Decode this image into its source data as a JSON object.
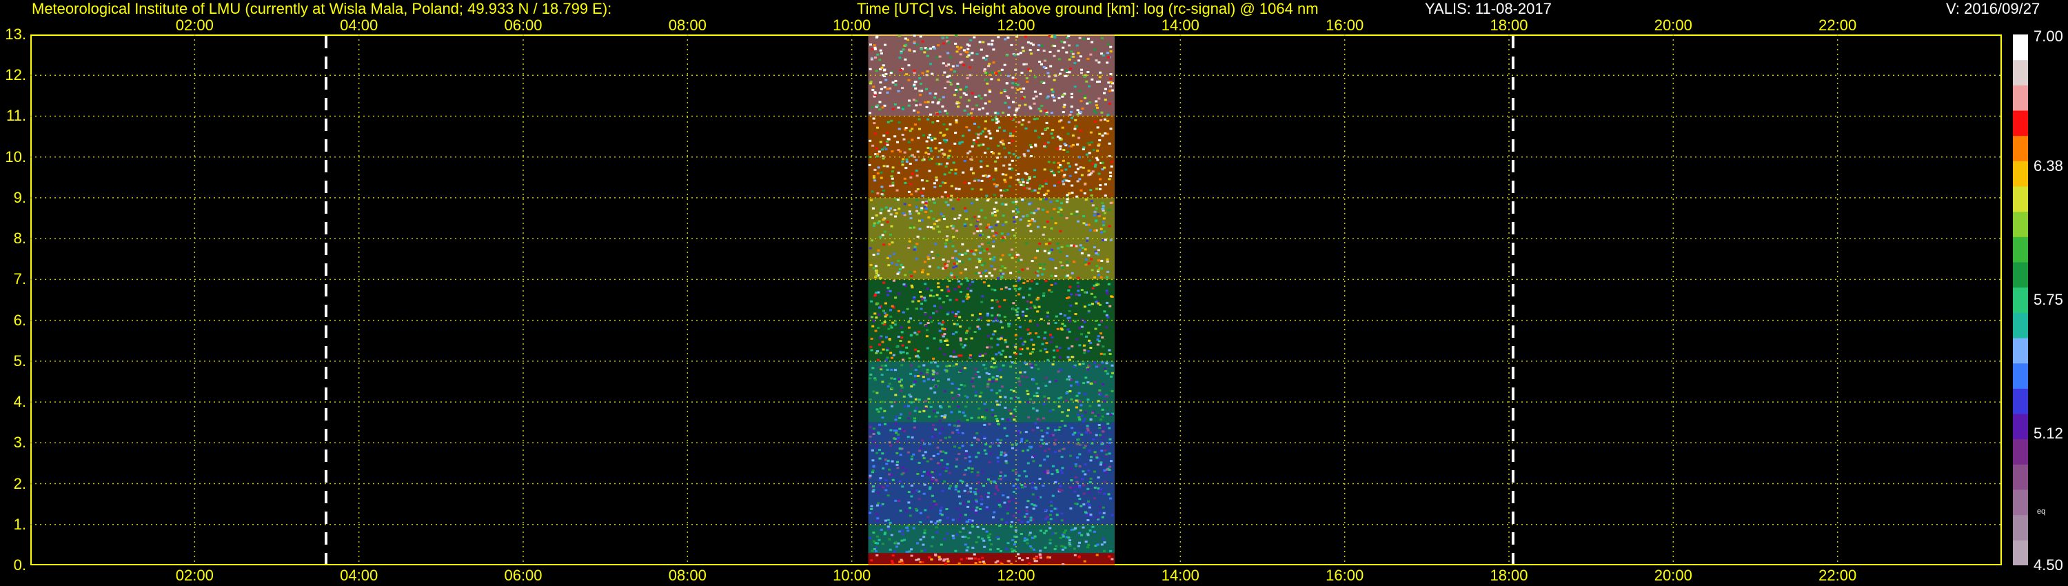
{
  "header": {
    "institute": "Meteorological Institute of LMU (currently at Wisla Mala, Poland; 49.933 N / 18.799 E):",
    "title": "Time [UTC] vs. Height above ground [km]: log (rc-signal) @ 1064 nm",
    "station": "YALIS: 11-08-2017",
    "version": "V: 2016/09/27"
  },
  "chart_data": {
    "type": "heatmap",
    "title": "Time [UTC] vs. Height above ground [km]: log (rc-signal) @ 1064 nm",
    "xlabel": "Time [UTC]",
    "ylabel": "Height above ground [km]",
    "xlim": [
      0,
      24
    ],
    "ylim": [
      0,
      13
    ],
    "x_ticks": [
      "02:00",
      "04:00",
      "06:00",
      "08:00",
      "10:00",
      "12:00",
      "14:00",
      "16:00",
      "18:00",
      "20:00",
      "22:00"
    ],
    "x_tick_values": [
      2,
      4,
      6,
      8,
      10,
      12,
      14,
      16,
      18,
      20,
      22
    ],
    "y_ticks": [
      "0.",
      "1.",
      "2.",
      "3.",
      "4.",
      "5.",
      "6.",
      "7.",
      "8.",
      "9.",
      "10.",
      "11.",
      "12.",
      "13."
    ],
    "y_tick_values": [
      0,
      1,
      2,
      3,
      4,
      5,
      6,
      7,
      8,
      9,
      10,
      11,
      12,
      13
    ],
    "grid": true,
    "data_window_utc": [
      10.2,
      13.2
    ],
    "vertical_markers_utc": [
      3.6,
      18.05
    ],
    "profile": [
      {
        "height_from": 0.0,
        "height_to": 0.3,
        "log_signal": 6.6
      },
      {
        "height_from": 0.3,
        "height_to": 1.0,
        "log_signal": 5.6
      },
      {
        "height_from": 1.0,
        "height_to": 2.0,
        "log_signal": 5.45
      },
      {
        "height_from": 2.0,
        "height_to": 3.5,
        "log_signal": 5.4
      },
      {
        "height_from": 3.5,
        "height_to": 5.0,
        "log_signal": 5.6
      },
      {
        "height_from": 5.0,
        "height_to": 7.0,
        "log_signal": 5.9
      },
      {
        "height_from": 7.0,
        "height_to": 9.0,
        "log_signal": 6.2
      },
      {
        "height_from": 9.0,
        "height_to": 11.0,
        "log_signal": 6.5
      },
      {
        "height_from": 11.0,
        "height_to": 13.0,
        "log_signal": 6.7
      }
    ],
    "colorbar": {
      "min": 4.5,
      "max": 7.0,
      "tick_labels": [
        "7.00",
        "6.38",
        "5.75",
        "5.12",
        "4.50"
      ],
      "tick_values": [
        7.0,
        6.38,
        5.75,
        5.12,
        4.5
      ],
      "sublabel": "eq",
      "colors": [
        "#b8a5b8",
        "#a58aa5",
        "#9a6f9a",
        "#8a4f8a",
        "#7a2a8a",
        "#5a1ab0",
        "#3a3ae0",
        "#3a7aff",
        "#7ab0ff",
        "#1fb8a0",
        "#28c878",
        "#1a9a40",
        "#3ab83a",
        "#8ad030",
        "#d8e030",
        "#f8c000",
        "#ff8000",
        "#ff1010",
        "#f0a0a0",
        "#e0d0d0",
        "#ffffff"
      ]
    }
  }
}
